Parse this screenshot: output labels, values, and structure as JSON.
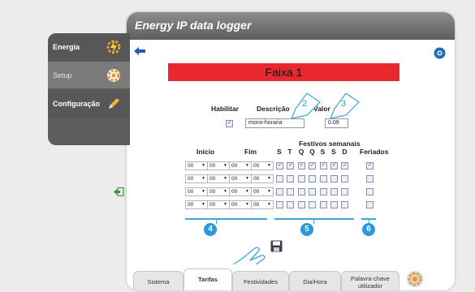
{
  "app": {
    "title": "Energy IP data logger"
  },
  "sidebar": {
    "items": [
      {
        "label": "Energia",
        "icon": "bolt-gear-icon"
      },
      {
        "label": "Setup",
        "icon": "gear-icon"
      },
      {
        "label": "Configuração",
        "icon": "pencil-icon"
      }
    ]
  },
  "band": {
    "title": "Faixa 1"
  },
  "form": {
    "enable_label": "Habilitar",
    "description_label": "Descrição",
    "value_label": "Valor",
    "description_value": "mono-horaria",
    "value_value": "0.09"
  },
  "schedule": {
    "festivos_label": "Festivos semanais",
    "start_label": "Inicio",
    "end_label": "Fim",
    "days": [
      "S",
      "T",
      "Q",
      "Q",
      "S",
      "S",
      "D"
    ],
    "holidays_label": "Feriados",
    "rows": [
      {
        "start_h": "00",
        "start_m": "00",
        "end_h": "00",
        "end_m": "00",
        "days_checked": [
          true,
          true,
          true,
          true,
          true,
          true,
          true
        ],
        "holiday": true
      },
      {
        "start_h": "00",
        "start_m": "00",
        "end_h": "00",
        "end_m": "00",
        "days_checked": [
          false,
          false,
          false,
          false,
          false,
          false,
          false
        ],
        "holiday": false
      },
      {
        "start_h": "00",
        "start_m": "00",
        "end_h": "00",
        "end_m": "00",
        "days_checked": [
          false,
          false,
          false,
          false,
          false,
          false,
          false
        ],
        "holiday": false
      },
      {
        "start_h": "00",
        "start_m": "00",
        "end_h": "00",
        "end_m": "00",
        "days_checked": [
          false,
          false,
          false,
          false,
          false,
          false,
          false
        ],
        "holiday": false
      }
    ]
  },
  "callouts": [
    "2",
    "3",
    "4",
    "5",
    "6",
    "7"
  ],
  "tabs": [
    {
      "label": "Sistema",
      "active": false
    },
    {
      "label": "Tarifas",
      "active": true
    },
    {
      "label": "Festividades",
      "active": false
    },
    {
      "label": "Dia/Hora",
      "active": false
    },
    {
      "label": "Palavra-chave utilizador",
      "active": false
    }
  ],
  "colors": {
    "accent": "#2a9adb",
    "band": "#e8272f",
    "titlebar": "#6e6e6e",
    "sidebar": "#5d5d5d"
  }
}
